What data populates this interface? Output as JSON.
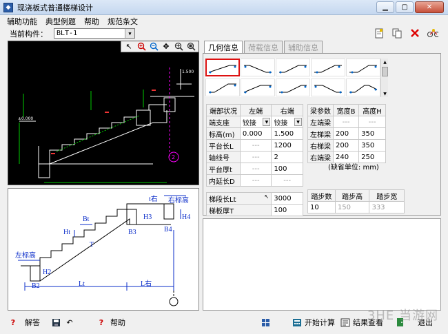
{
  "window": {
    "title": "现浇板式普通楼梯设计",
    "app_icon": "app-logo-icon"
  },
  "menu": [
    "辅助功能",
    "典型例题",
    "帮助",
    "规范条文"
  ],
  "component": {
    "label": "当前构件：",
    "value": "BLT-1"
  },
  "tabs": [
    {
      "label": "几何信息",
      "active": true
    },
    {
      "label": "荷载信息",
      "active": false
    },
    {
      "label": "辅助信息",
      "active": false
    }
  ],
  "end_table": {
    "headers": [
      "端部状况",
      "左端",
      "右端"
    ],
    "rows": [
      {
        "label": "端支座",
        "left": "铰接",
        "right": "铰接"
      },
      {
        "label": "标高(m)",
        "left": "0.000",
        "right": "1.500"
      },
      {
        "label": "平台长L",
        "left": "---",
        "right": "1200"
      },
      {
        "label": "轴线号",
        "left": "---",
        "right": "2"
      },
      {
        "label": "平台厚t",
        "left": "---",
        "right": "100"
      },
      {
        "label": "内延长D",
        "left": "---",
        "right": "---"
      }
    ]
  },
  "beam_table": {
    "headers": [
      "梁参数",
      "宽度B",
      "高度H"
    ],
    "rows": [
      {
        "label": "左端梁",
        "b": "---",
        "h": "---"
      },
      {
        "label": "左梯梁",
        "b": "200",
        "h": "350"
      },
      {
        "label": "右梯梁",
        "b": "200",
        "h": "350"
      },
      {
        "label": "右端梁",
        "b": "240",
        "h": "250"
      }
    ],
    "note": "(缺省单位: mm)"
  },
  "segment_table": {
    "rows": [
      {
        "label": "梯段长Lt",
        "value": "3000"
      },
      {
        "label": "梯板厚T",
        "value": "100"
      }
    ]
  },
  "step_table": {
    "headers": [
      "踏步数",
      "踏步高",
      "踏步宽"
    ],
    "values": [
      "10",
      "150",
      "333"
    ]
  },
  "cad": {
    "elev_top": "1.500",
    "elev_left": "±0.000",
    "axis_no": "2"
  },
  "schematic": {
    "labels": {
      "bt": "Bt",
      "ht": "Ht",
      "t": "T",
      "h2": "H2",
      "b2": "B2",
      "lt": "Lt",
      "b3": "B3",
      "h3": "H3",
      "t_right": "t右",
      "right_elev": "右标高",
      "h4": "H4",
      "b4": "B4",
      "left_elev": "左标高",
      "l_right": "L右"
    }
  },
  "bottom": {
    "answer": "解答",
    "help": "帮助",
    "calc": "开始计算",
    "result": "结果查看",
    "exit": "退出"
  },
  "watermark": "3HE 当游网"
}
